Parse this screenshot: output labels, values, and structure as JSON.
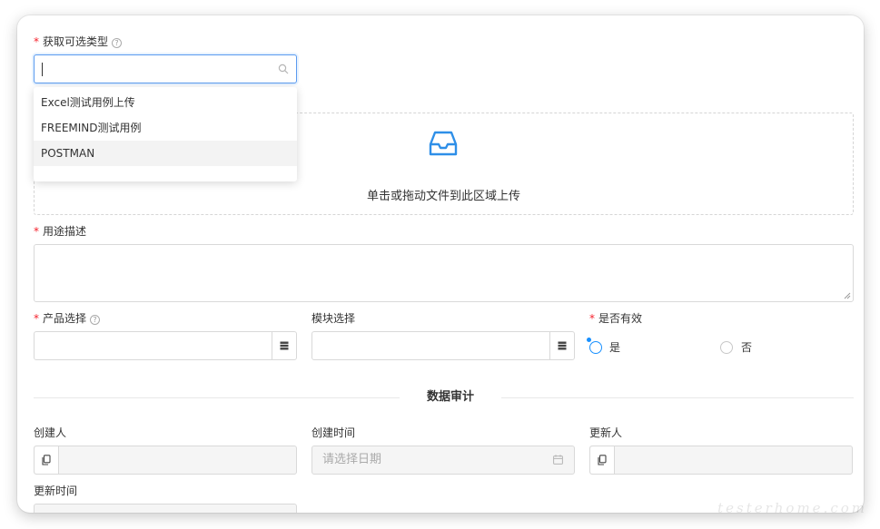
{
  "form": {
    "type_label": "获取可选类型",
    "type_search_value": "",
    "type_options": [
      {
        "label": "Excel测试用例上传"
      },
      {
        "label": "FREEMIND测试用例"
      },
      {
        "label": "POSTMAN"
      }
    ],
    "upload_text": "单击或拖动文件到此区域上传",
    "purpose_label": "用途描述",
    "product_label": "产品选择",
    "module_label": "模块选择",
    "valid_label": "是否有效",
    "valid_yes": "是",
    "valid_no": "否",
    "required_mark": "*"
  },
  "audit": {
    "section_title": "数据审计",
    "creator_label": "创建人",
    "create_time_label": "创建时间",
    "create_time_placeholder": "请选择日期",
    "updater_label": "更新人",
    "update_time_label": "更新时间"
  },
  "watermark": "testerhome.com",
  "colors": {
    "accent": "#1890ff",
    "required": "#f5222d",
    "upload_icon": "#2e8fe8"
  }
}
